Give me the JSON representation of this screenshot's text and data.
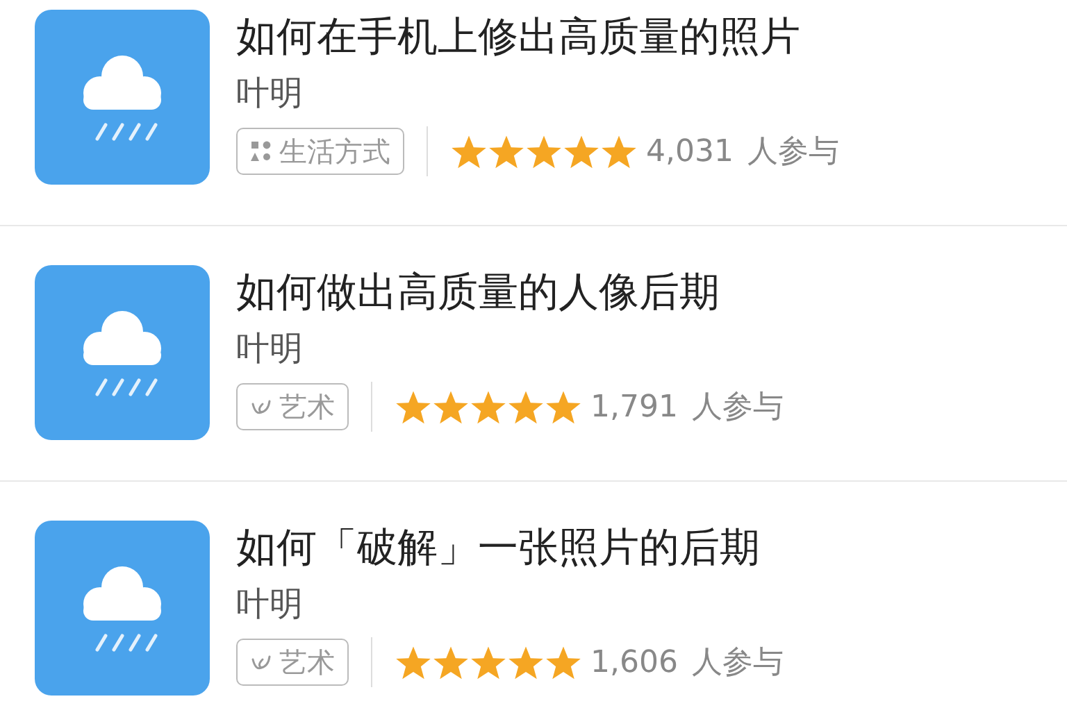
{
  "courses": [
    {
      "title": "如何在手机上修出高质量的照片",
      "author": "叶明",
      "tag": {
        "kind": "lifestyle",
        "label": "生活方式"
      },
      "stars": 5,
      "count": "4,031",
      "count_label": "人参与"
    },
    {
      "title": "如何做出高质量的人像后期",
      "author": "叶明",
      "tag": {
        "kind": "art",
        "label": "艺术"
      },
      "stars": 5,
      "count": "1,791",
      "count_label": "人参与"
    },
    {
      "title": "如何「破解」一张照片的后期",
      "author": "叶明",
      "tag": {
        "kind": "art",
        "label": "艺术"
      },
      "stars": 5,
      "count": "1,606",
      "count_label": "人参与"
    }
  ]
}
